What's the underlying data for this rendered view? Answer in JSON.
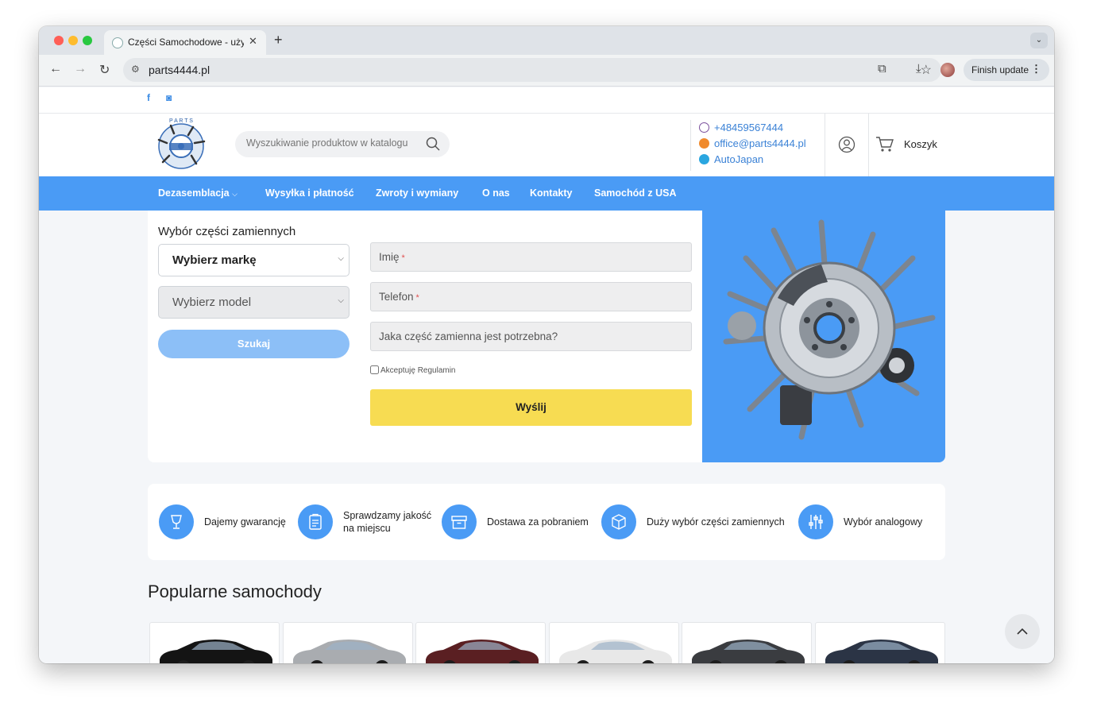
{
  "browser": {
    "tab_title": "Części Samochodowe - używ",
    "tab_close": "✕",
    "new_tab": "+",
    "url": "parts4444.pl",
    "finish_update": "Finish update"
  },
  "header": {
    "search_placeholder": "Wyszukiwanie produktow w katalogu",
    "phone": "+48459567444",
    "email": "office@parts4444.pl",
    "skype": "AutoJapan",
    "cart_label": "Koszyk"
  },
  "nav": {
    "items": [
      {
        "label": "Dezasemblacja"
      },
      {
        "label": "Wysyłka i płatność"
      },
      {
        "label": "Zwroty i wymiany"
      },
      {
        "label": "O nas"
      },
      {
        "label": "Kontakty"
      },
      {
        "label": "Samochód z USA"
      }
    ]
  },
  "form": {
    "title": "Wybór części zamiennych",
    "brand_select": "Wybierz markę",
    "model_select": "Wybierz model",
    "search_button": "Szukaj",
    "name_placeholder": "Imię",
    "phone_placeholder": "Telefon",
    "part_placeholder": "Jaka część zamienna jest potrzebna?",
    "required_mark": "*",
    "accept_label": "Akceptuję Regulamin",
    "submit_button": "Wyślij"
  },
  "features": [
    {
      "label": "Dajemy gwarancję",
      "icon": "trophy-icon"
    },
    {
      "label": "Sprawdzamy jakość na miejscu",
      "icon": "clipboard-icon"
    },
    {
      "label": "Dostawa za pobraniem",
      "icon": "archive-box-icon"
    },
    {
      "label": "Duży wybór części zamiennych",
      "icon": "cube-icon"
    },
    {
      "label": "Wybór analogowy",
      "icon": "sliders-icon"
    }
  ],
  "popular": {
    "title": "Popularne samochody",
    "car_colors": [
      "#141414",
      "#a9acb0",
      "#5a1f22",
      "#e8e8e8",
      "#3a3c40",
      "#2b3445"
    ]
  },
  "colors": {
    "accent": "#4a9bf5",
    "submit": "#f7dc52",
    "link": "#3b82d6"
  }
}
